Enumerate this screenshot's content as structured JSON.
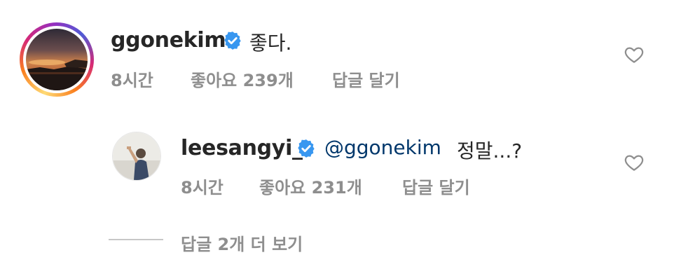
{
  "comments": [
    {
      "username": "ggonekim",
      "text": "좋다.",
      "mention": "",
      "time": "8시간",
      "likes": "좋아요 239개",
      "reply": "답글 달기",
      "verified": true
    },
    {
      "username": "leesangyi_",
      "mention": "@ggonekim",
      "text": "정말...?",
      "time": "8시간",
      "likes": "좋아요 231개",
      "reply": "답글 달기",
      "verified": true
    }
  ],
  "view_more_replies": "답글 2개 더 보기",
  "colors": {
    "verified_badge": "#3897f0",
    "mention": "#00376b",
    "meta_gray": "#8e8e8e",
    "text": "#262626"
  },
  "icons": [
    "verified-badge-icon",
    "heart-icon"
  ]
}
